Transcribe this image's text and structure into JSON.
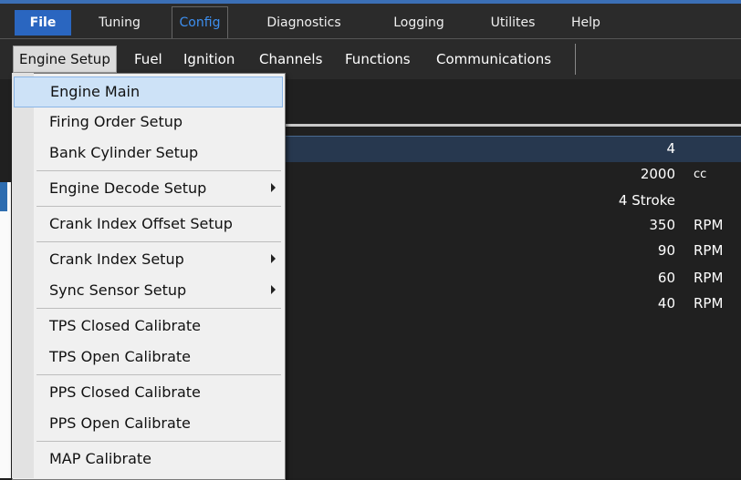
{
  "ribbon_tabs": [
    "File",
    "Tuning",
    "Config",
    "Diagnostics",
    "Logging",
    "Utilites",
    "Help"
  ],
  "menubar": [
    "Engine Setup",
    "Fuel",
    "Ignition",
    "Channels",
    "Functions",
    "Communications"
  ],
  "dropdown": [
    "Engine Main",
    "Firing Order Setup",
    "Bank Cylinder Setup",
    "Engine Decode Setup",
    "Crank Index Offset Setup",
    "Crank Index Setup",
    "Sync Sensor Setup",
    "TPS Closed Calibrate",
    "TPS Open Calibrate",
    "PPS Closed Calibrate",
    "PPS Open Calibrate",
    "MAP Calibrate"
  ],
  "table": [
    {
      "value": "4",
      "unit": ""
    },
    {
      "value": "2000",
      "unit": "cc"
    },
    {
      "value": "4 Stroke",
      "unit": ""
    },
    {
      "value": "350",
      "unit": "RPM"
    },
    {
      "value": "90",
      "unit": "RPM"
    },
    {
      "value": "60",
      "unit": "RPM"
    },
    {
      "value": "40",
      "unit": "RPM"
    }
  ],
  "colors": {
    "accent": "#2a66c0",
    "config_tab": "#3d8ff0",
    "highlight": "#cde2f7"
  }
}
